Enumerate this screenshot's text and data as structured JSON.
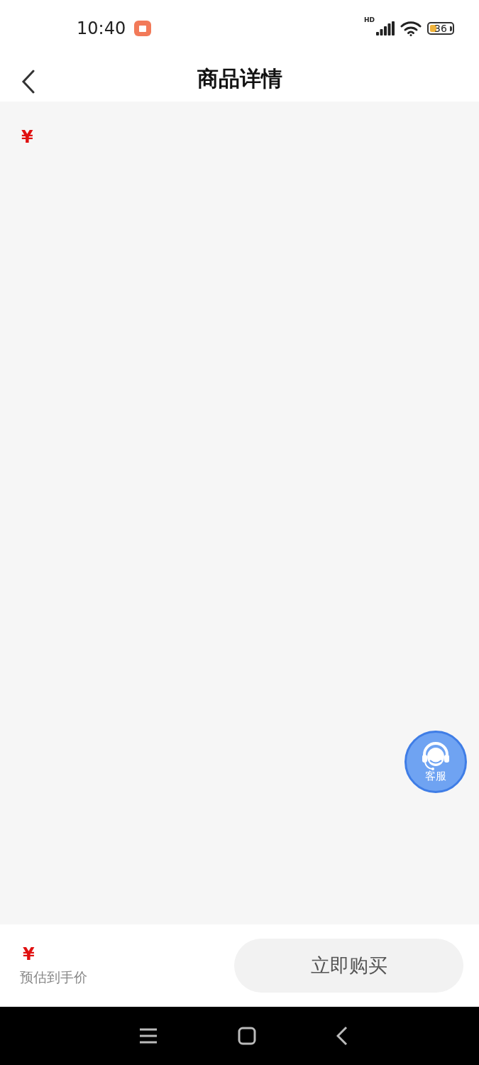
{
  "status_bar": {
    "time": "10:40",
    "network": "HD",
    "battery": "36"
  },
  "header": {
    "title": "商品详情"
  },
  "content": {
    "price_symbol": "¥"
  },
  "service_button": {
    "label": "客服"
  },
  "bottom_bar": {
    "price_symbol": "¥",
    "price_note": "预估到手价",
    "buy_button": {
      "label": "立即购买",
      "disabled": true
    }
  }
}
